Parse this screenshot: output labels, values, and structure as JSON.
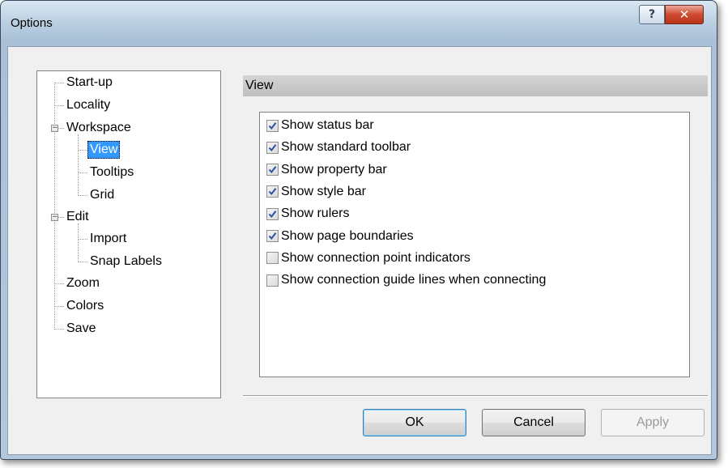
{
  "window": {
    "title": "Options",
    "help_glyph": "?",
    "close_glyph": "✕"
  },
  "tree": {
    "items": [
      {
        "label": "Start-up"
      },
      {
        "label": "Locality"
      },
      {
        "label": "Workspace",
        "expanded": true
      },
      {
        "label": "View",
        "selected": true
      },
      {
        "label": "Tooltips"
      },
      {
        "label": "Grid"
      },
      {
        "label": "Edit",
        "expanded": true
      },
      {
        "label": "Import"
      },
      {
        "label": "Snap Labels"
      },
      {
        "label": "Zoom"
      },
      {
        "label": "Colors"
      },
      {
        "label": "Save"
      }
    ],
    "collapse_glyph": "−"
  },
  "panel": {
    "header": "View",
    "options": [
      {
        "label": "Show status bar",
        "checked": true
      },
      {
        "label": "Show standard toolbar",
        "checked": true
      },
      {
        "label": "Show property bar",
        "checked": true
      },
      {
        "label": "Show style bar",
        "checked": true
      },
      {
        "label": "Show rulers",
        "checked": true
      },
      {
        "label": "Show page boundaries",
        "checked": true
      },
      {
        "label": "Show connection point indicators",
        "checked": false
      },
      {
        "label": "Show connection guide lines when connecting",
        "checked": false
      }
    ]
  },
  "buttons": {
    "ok": "OK",
    "cancel": "Cancel",
    "apply": "Apply"
  },
  "colors": {
    "selection": "#3399ff",
    "check": "#2b4fa8",
    "close_button": "#cf4a32"
  }
}
